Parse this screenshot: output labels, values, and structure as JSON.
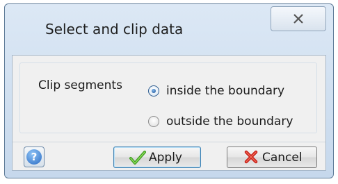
{
  "window": {
    "title": "Select and clip data"
  },
  "options": {
    "group_label": "Clip segments",
    "radios": [
      {
        "label": "inside the boundary",
        "checked": true
      },
      {
        "label": "outside the boundary",
        "checked": false
      }
    ]
  },
  "buttons": {
    "help_icon": "question-mark-icon",
    "apply_label": "Apply",
    "apply_icon": "checkmark-icon",
    "cancel_label": "Cancel",
    "cancel_icon": "red-x-icon"
  }
}
